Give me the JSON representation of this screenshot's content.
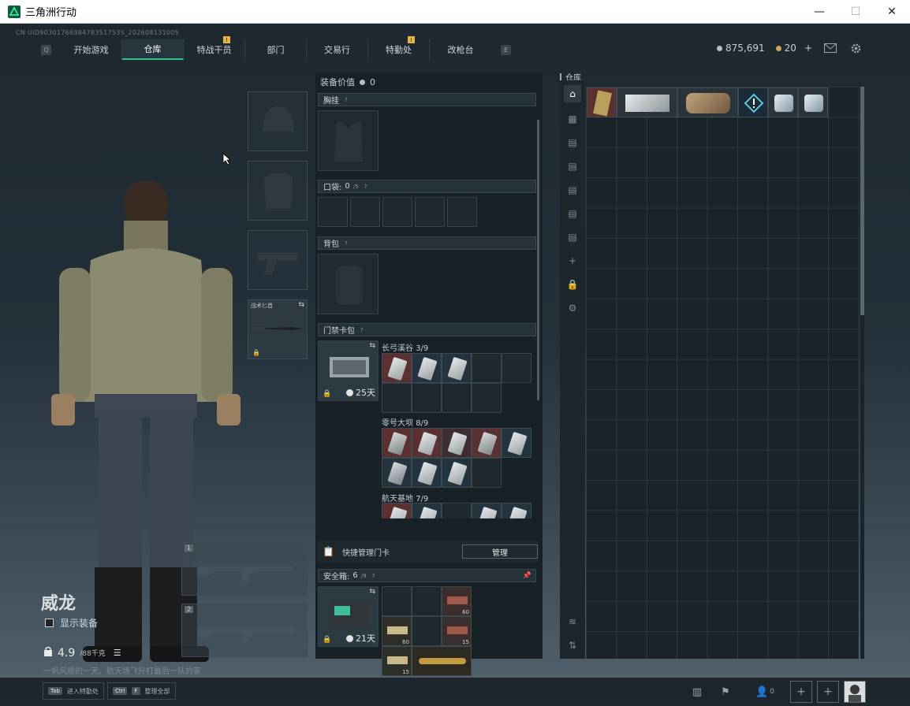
{
  "window": {
    "title": "三角洲行动",
    "minimize": "—",
    "maximize": "☐",
    "close": "✕"
  },
  "uid": "CN UID9030176698478351753S_202608131005",
  "nav": {
    "key_left": "Q",
    "key_right": "E",
    "tabs": [
      {
        "label": "开始游戏",
        "badge": ""
      },
      {
        "label": "仓库",
        "badge": ""
      },
      {
        "label": "特战干员",
        "badge": "!"
      },
      {
        "label": "部门",
        "badge": ""
      },
      {
        "label": "交易行",
        "badge": ""
      },
      {
        "label": "特勤处",
        "badge": "!"
      },
      {
        "label": "改枪台",
        "badge": ""
      }
    ]
  },
  "currency": {
    "silver": "875,691",
    "gold": "20",
    "plus": "+"
  },
  "character": {
    "name": "威龙",
    "show_equipment": "显示装备",
    "weight": "4.9",
    "weight_max": "/88千克",
    "subtitle": "一帆风顺的一天。航天场飞升打最后一队的家"
  },
  "equip_slots": {
    "melee_label": "战术匕首",
    "weapon1_num": "1",
    "weapon2_num": "2"
  },
  "middle": {
    "header": "装备价值",
    "value": "0",
    "chest": "胸挂",
    "pockets": "口袋:",
    "pockets_count": "0",
    "pockets_max": "/5",
    "backpack": "背包",
    "keycard": "门禁卡包",
    "keycard_days": "25天",
    "maps": [
      {
        "name": "长弓溪谷",
        "count": "3/9"
      },
      {
        "name": "零号大坝",
        "count": "8/9"
      },
      {
        "name": "航天基地",
        "count": "7/9"
      }
    ],
    "quick_manage": "快捷管理门卡",
    "manage_btn": "管理",
    "safebox": "安全箱:",
    "safebox_count": "6",
    "safebox_max": "/9",
    "safebox_days": "21天",
    "safebox_items": [
      "60",
      "60",
      "15",
      "15"
    ]
  },
  "storage": {
    "title": "仓库"
  },
  "bottom": {
    "hint1_key": "Tab",
    "hint1_label": "进入特勤处",
    "hint2_key": "Ctrl",
    "hint2_key2": "F",
    "hint2_label": "整理全部",
    "friends": "0"
  },
  "colors": {
    "accent": "#2fc38a",
    "badge": "#e8b43c"
  }
}
